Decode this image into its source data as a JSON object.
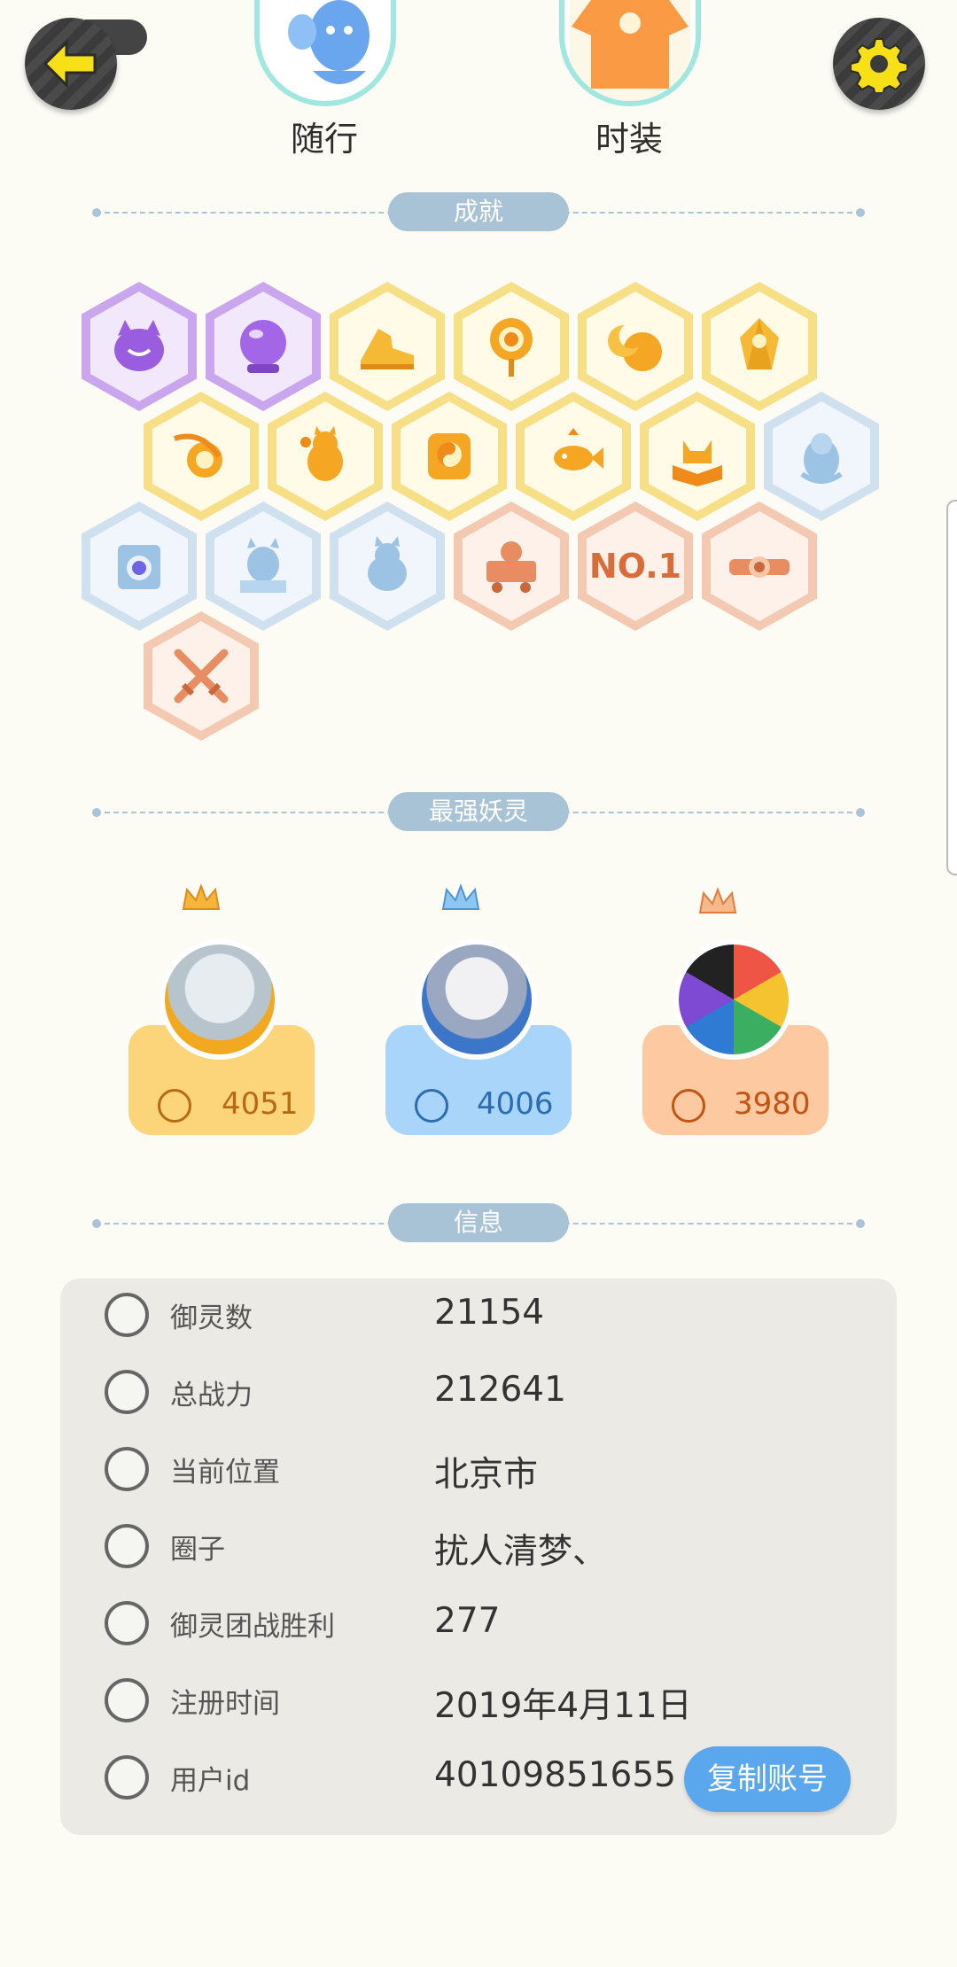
{
  "top": {
    "back_icon": "back-arrow-icon",
    "settings_icon": "gear-icon",
    "follow_label": "随行",
    "fashion_label": "时装"
  },
  "sections": {
    "achievements": "成就",
    "strongest": "最强妖灵",
    "info": "信息"
  },
  "achievements": [
    {
      "color": "purple",
      "icon": "cat-chat-icon"
    },
    {
      "color": "purple",
      "icon": "crystal-ball-icon"
    },
    {
      "color": "yellow",
      "icon": "sneaker-icon"
    },
    {
      "color": "yellow",
      "icon": "target-icon"
    },
    {
      "color": "yellow",
      "icon": "moon-icon"
    },
    {
      "color": "yellow",
      "icon": "gem-icon"
    },
    {
      "color": "yellow",
      "icon": "yin-yang-icon"
    },
    {
      "color": "yellow",
      "icon": "cat-flower-icon"
    },
    {
      "color": "yellow",
      "icon": "taiji-block-icon"
    },
    {
      "color": "yellow",
      "icon": "fish-icon"
    },
    {
      "color": "yellow",
      "icon": "fox-book-icon"
    },
    {
      "color": "blue",
      "icon": "spirit-icon"
    },
    {
      "color": "blue",
      "icon": "portal-icon"
    },
    {
      "color": "blue",
      "icon": "monster-statue-icon"
    },
    {
      "color": "blue",
      "icon": "cat-silhouette-icon"
    },
    {
      "color": "peach",
      "icon": "cart-icon"
    },
    {
      "color": "peach",
      "icon": "no1-icon",
      "text": "NO.1"
    },
    {
      "color": "peach",
      "icon": "belt-icon"
    },
    {
      "color": "peach",
      "icon": "crossed-swords-icon"
    }
  ],
  "spirits": [
    {
      "power": "4051",
      "color": "#fcd47a",
      "text_color": "#b86a12"
    },
    {
      "power": "4006",
      "color": "#a9d5fb",
      "text_color": "#2b6cb3"
    },
    {
      "power": "3980",
      "color": "#fcc9a0",
      "text_color": "#c45416"
    }
  ],
  "info": {
    "rows": [
      {
        "label": "御灵数",
        "value": "21154",
        "icon": "spirit-count-icon"
      },
      {
        "label": "总战力",
        "value": "212641",
        "icon": "sword-icon"
      },
      {
        "label": "当前位置",
        "value": "北京市",
        "icon": "location-pin-icon"
      },
      {
        "label": "圈子",
        "value": "扰人清梦、",
        "icon": "circle-icon"
      },
      {
        "label": "御灵团战胜利",
        "value": "277",
        "icon": "trophy-icon"
      },
      {
        "label": "注册时间",
        "value": "2019年4月11日",
        "icon": "clock-icon"
      },
      {
        "label": "用户id",
        "value": "40109851655",
        "icon": "id-card-icon"
      }
    ],
    "copy_button": "复制账号"
  }
}
